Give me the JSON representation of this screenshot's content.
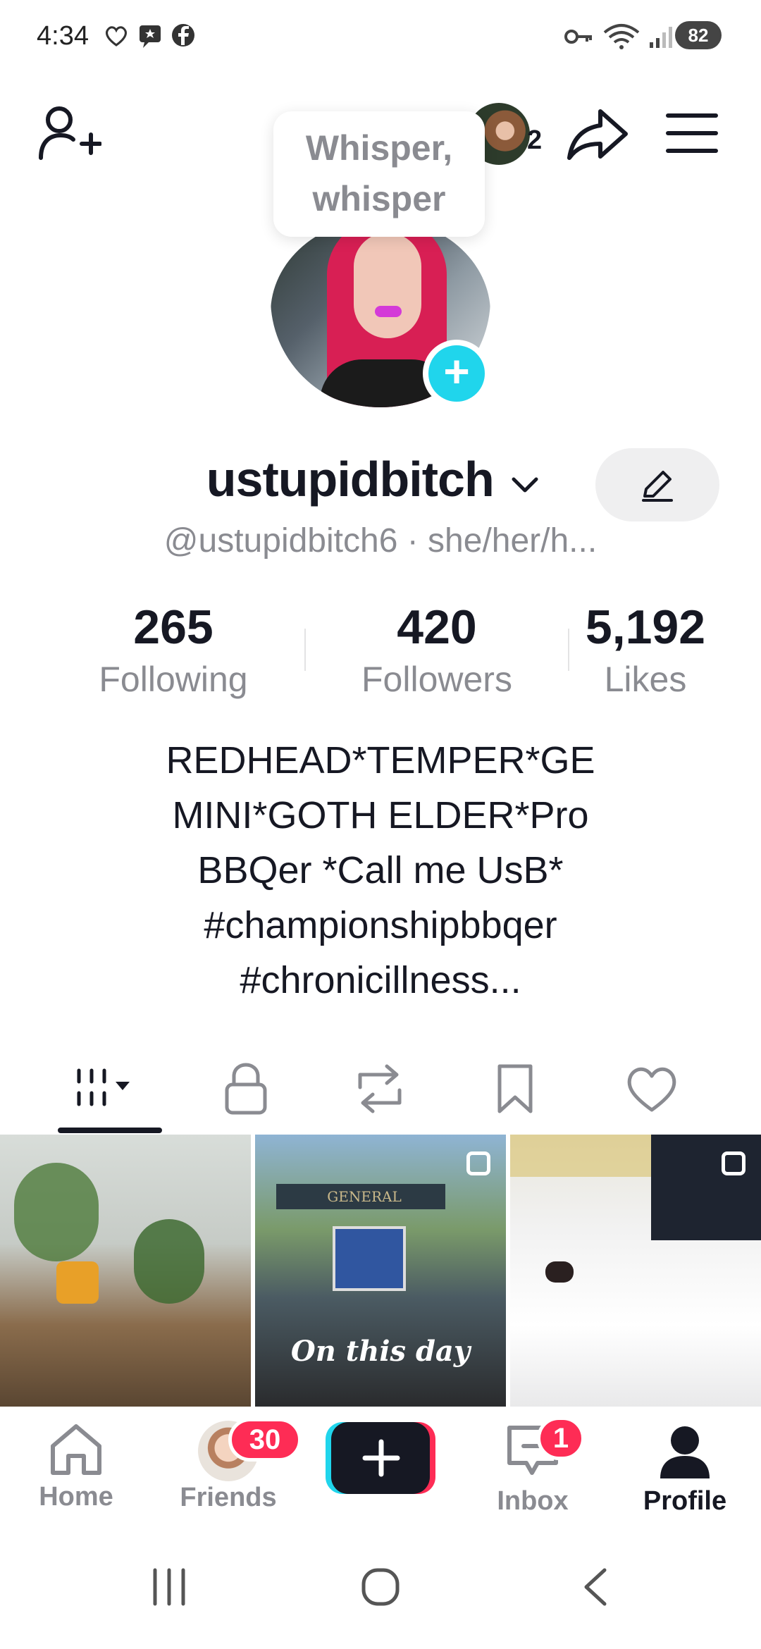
{
  "status_bar": {
    "time": "4:34",
    "battery": "82",
    "icons": [
      "heart-icon",
      "chat-icon",
      "facebook-icon",
      "key-icon",
      "wifi-icon",
      "signal-icon"
    ]
  },
  "top_bar": {
    "whisper_text_line1": "Whisper,",
    "whisper_text_line2": "whisper",
    "viewers_count": "2",
    "icons": [
      "add-friend-icon",
      "share-icon",
      "menu-icon"
    ]
  },
  "profile": {
    "display_name": "ustupidbitch",
    "handle_line": "@ustupidbitch6 · she/her/h...",
    "stats": [
      {
        "value": "265",
        "label": "Following"
      },
      {
        "value": "420",
        "label": "Followers"
      },
      {
        "value": "5,192",
        "label": "Likes"
      }
    ],
    "bio_lines": [
      "REDHEAD*TEMPER*GE",
      "MINI*GOTH ELDER*Pro",
      "BBQer *Call me UsB*",
      "#championshipbbqer",
      "#chronicillness..."
    ]
  },
  "content_tabs": [
    "videos-grid-icon",
    "private-lock-icon",
    "repost-icon",
    "bookmark-icon",
    "liked-heart-icon"
  ],
  "grid": {
    "item2_caption": "On this day",
    "item2_sign": "GENERAL"
  },
  "bottom_nav": {
    "home": "Home",
    "friends": "Friends",
    "friends_badge": "30",
    "inbox": "Inbox",
    "inbox_badge": "1",
    "profile": "Profile"
  },
  "colors": {
    "accent_red": "#fe2c55",
    "accent_cyan": "#20d5ec",
    "text_primary": "#161823",
    "text_secondary": "#8a8b91"
  }
}
